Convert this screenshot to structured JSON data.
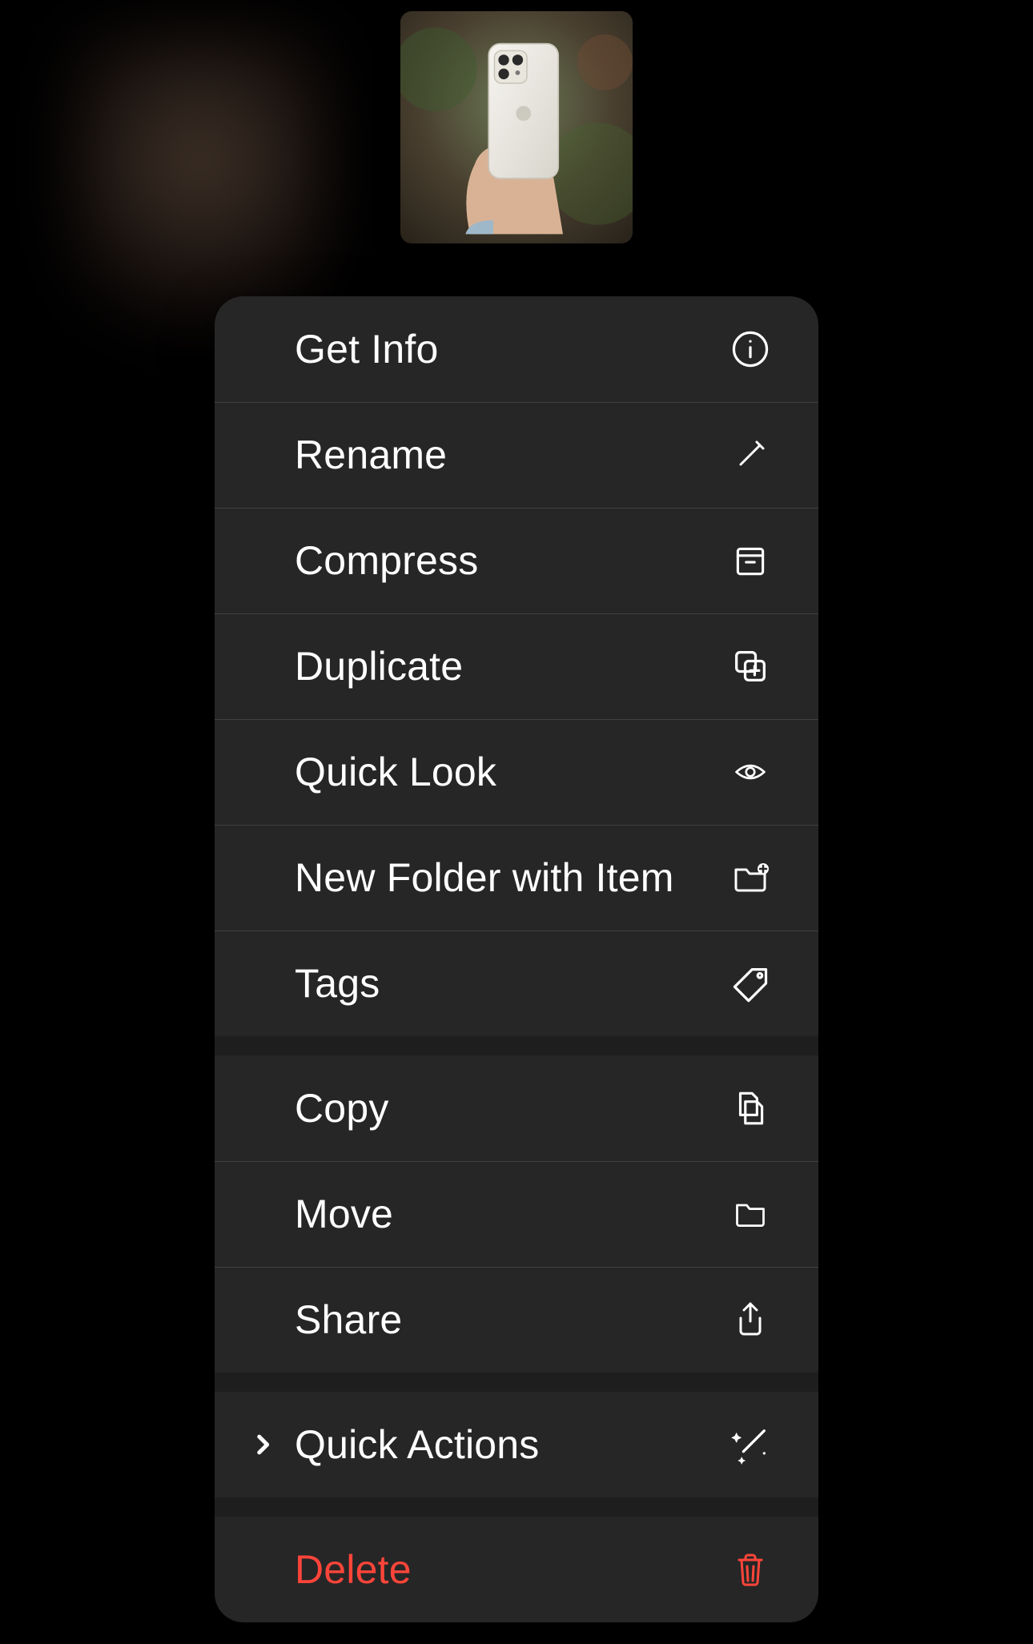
{
  "preview": {
    "alt": "photo-thumbnail"
  },
  "menu": {
    "group1": {
      "get_info": {
        "label": "Get Info",
        "icon": "info-icon"
      },
      "rename": {
        "label": "Rename",
        "icon": "pencil-icon"
      },
      "compress": {
        "label": "Compress",
        "icon": "archive-icon"
      },
      "duplicate": {
        "label": "Duplicate",
        "icon": "duplicate-icon"
      },
      "quick_look": {
        "label": "Quick Look",
        "icon": "eye-icon"
      },
      "new_folder": {
        "label": "New Folder with Item",
        "icon": "folder-plus-icon"
      },
      "tags": {
        "label": "Tags",
        "icon": "tag-icon"
      }
    },
    "group2": {
      "copy": {
        "label": "Copy",
        "icon": "doc-on-doc-icon"
      },
      "move": {
        "label": "Move",
        "icon": "folder-icon"
      },
      "share": {
        "label": "Share",
        "icon": "share-icon"
      }
    },
    "group3": {
      "quick_actions": {
        "label": "Quick Actions",
        "icon": "magic-wand-icon"
      }
    },
    "group4": {
      "delete": {
        "label": "Delete",
        "icon": "trash-icon"
      }
    }
  },
  "colors": {
    "menu_bg": "#262626",
    "gap_bg": "#1e1e1e",
    "text": "#ffffff",
    "destructive": "#ff453a"
  }
}
